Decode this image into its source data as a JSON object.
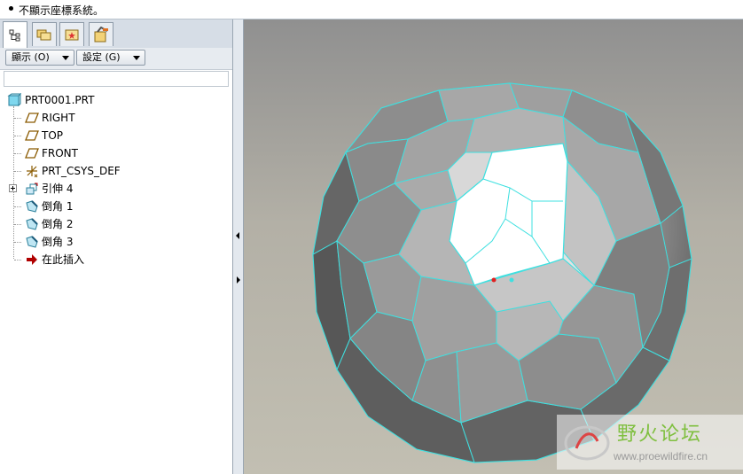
{
  "message_bar": {
    "text": "不顯示座標系統。"
  },
  "tabs": [
    {
      "name": "model-tree-tab",
      "icon": "model-tree-icon"
    },
    {
      "name": "folder-browser-tab",
      "icon": "folder-browser-icon"
    },
    {
      "name": "favorites-tab",
      "icon": "favorites-icon"
    },
    {
      "name": "connections-tab",
      "icon": "connections-icon"
    }
  ],
  "toolbar": {
    "show_label": "顯示 (O)",
    "settings_label": "設定 (G)"
  },
  "tree": {
    "root": {
      "label": "PRT0001.PRT",
      "icon": "part-icon"
    },
    "items": [
      {
        "label": "RIGHT",
        "icon": "datum-plane-icon"
      },
      {
        "label": "TOP",
        "icon": "datum-plane-icon"
      },
      {
        "label": "FRONT",
        "icon": "datum-plane-icon"
      },
      {
        "label": "PRT_CSYS_DEF",
        "icon": "csys-icon"
      },
      {
        "label": "引伸 4",
        "icon": "extrude-icon",
        "expandable": true
      },
      {
        "label": "倒角 1",
        "icon": "chamfer-icon"
      },
      {
        "label": "倒角 2",
        "icon": "chamfer-icon"
      },
      {
        "label": "倒角 3",
        "icon": "chamfer-icon"
      },
      {
        "label": "在此插入",
        "icon": "insert-here-arrow-icon"
      }
    ]
  },
  "watermark": {
    "title": "野火论坛",
    "url": "www.proewildfire.cn"
  },
  "colors": {
    "edge": "#3fe0e0",
    "viewport_bg": "#b3b0a6",
    "model_dark": "#5a5a5a",
    "model_light": "#a9a9a9",
    "highlight_face": "#ffffff",
    "insert_arrow": "#b00000"
  }
}
